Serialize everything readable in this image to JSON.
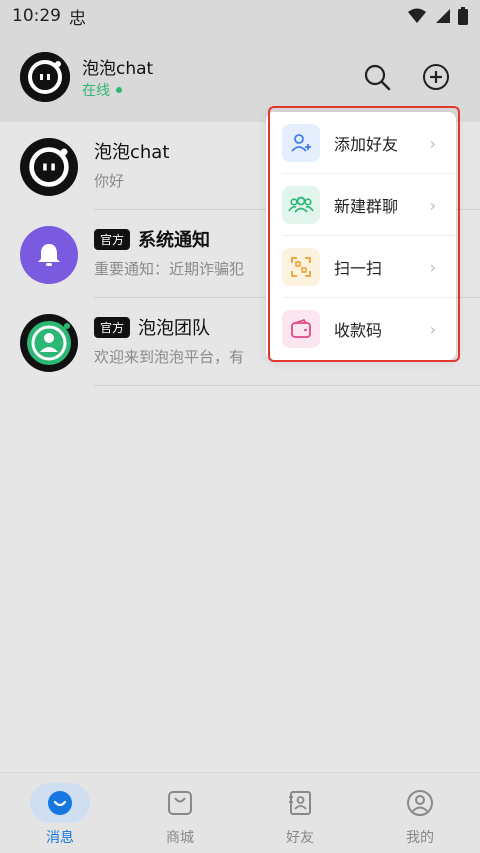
{
  "status_bar": {
    "time": "10:29",
    "notification_glyph": "忠"
  },
  "header": {
    "name": "泡泡chat",
    "status": "在线"
  },
  "conversations": [
    {
      "name": "泡泡chat",
      "snippet": "你好",
      "official": false
    },
    {
      "badge": "官方",
      "name": "系统通知",
      "snippet": "重要通知：近期诈骗犯",
      "official": true
    },
    {
      "badge": "官方",
      "name": "泡泡团队",
      "snippet": "欢迎来到泡泡平台，有",
      "official": true
    }
  ],
  "menu": {
    "items": [
      {
        "label": "添加好友",
        "icon": "add-user-icon",
        "color": "#3f7ee8",
        "bg": "#e4eefc"
      },
      {
        "label": "新建群聊",
        "icon": "group-icon",
        "color": "#2db774",
        "bg": "#e2f5ec"
      },
      {
        "label": "扫一扫",
        "icon": "scan-icon",
        "color": "#f0a030",
        "bg": "#fdf1e0"
      },
      {
        "label": "收款码",
        "icon": "wallet-icon",
        "color": "#e04a8a",
        "bg": "#fbe6ef"
      }
    ]
  },
  "bottom_nav": [
    {
      "label": "消息",
      "icon": "message-icon",
      "active": true
    },
    {
      "label": "商城",
      "icon": "shop-bag-icon",
      "active": false
    },
    {
      "label": "好友",
      "icon": "contacts-icon",
      "active": false
    },
    {
      "label": "我的",
      "icon": "profile-icon",
      "active": false
    }
  ],
  "colors": {
    "accent": "#1677e0",
    "online": "#2db774",
    "highlight": "#e0392b"
  }
}
